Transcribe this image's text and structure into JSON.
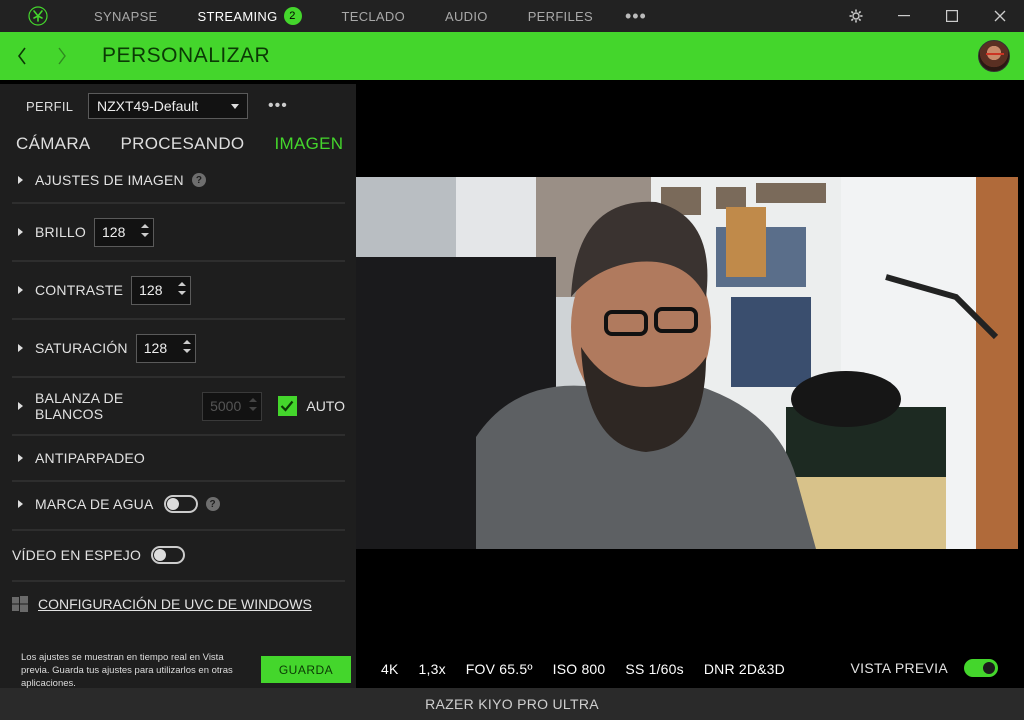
{
  "titlebar": {
    "nav": [
      {
        "label": "SYNAPSE",
        "active": false
      },
      {
        "label": "STREAMING",
        "active": true,
        "badge": "2"
      },
      {
        "label": "TECLADO",
        "active": false
      },
      {
        "label": "AUDIO",
        "active": false
      },
      {
        "label": "PERFILES",
        "active": false
      }
    ],
    "more": "•••",
    "icons": [
      "razer-logo-icon",
      "gear-icon",
      "minimize-icon",
      "maximize-icon",
      "close-icon"
    ]
  },
  "header": {
    "title": "PERSONALIZAR",
    "color": "#44d62c"
  },
  "profile": {
    "label": "PERFIL",
    "value": "NZXT49-Default",
    "more": "•••"
  },
  "tabs": [
    {
      "label": "CÁMARA",
      "active": false
    },
    {
      "label": "PROCESANDO",
      "active": false
    },
    {
      "label": "IMAGEN",
      "active": true
    }
  ],
  "settings": {
    "image_adjust": {
      "label": "AJUSTES DE IMAGEN",
      "help": "?"
    },
    "brightness": {
      "label": "BRILLO",
      "value": "128"
    },
    "contrast": {
      "label": "CONTRASTE",
      "value": "128"
    },
    "saturation": {
      "label": "SATURACIÓN",
      "value": "128"
    },
    "white_balance": {
      "label": "BALANZA DE BLANCOS",
      "value": "5000",
      "auto_label": "AUTO",
      "auto": true
    },
    "antiflicker": {
      "label": "ANTIPARPADEO"
    },
    "watermark": {
      "label": "MARCA DE AGUA",
      "on": false,
      "help": "?"
    },
    "mirror": {
      "label": "VÍDEO EN ESPEJO",
      "on": false
    },
    "uvc": {
      "label": "CONFIGURACIÓN DE UVC DE WINDOWS"
    }
  },
  "footer": {
    "note": "Los ajustes se muestran en tiempo real en Vista previa. Guarda tus ajustes para utilizarlos en otras aplicaciones.",
    "save_label": "GUARDA",
    "stats": [
      "4K",
      "1,3x",
      "FOV 65.5º",
      "ISO 800",
      "SS 1/60s",
      "DNR 2D&3D"
    ],
    "preview_label": "VISTA PREVIA",
    "preview_on": true
  },
  "device": {
    "name": "RAZER KIYO PRO ULTRA"
  }
}
